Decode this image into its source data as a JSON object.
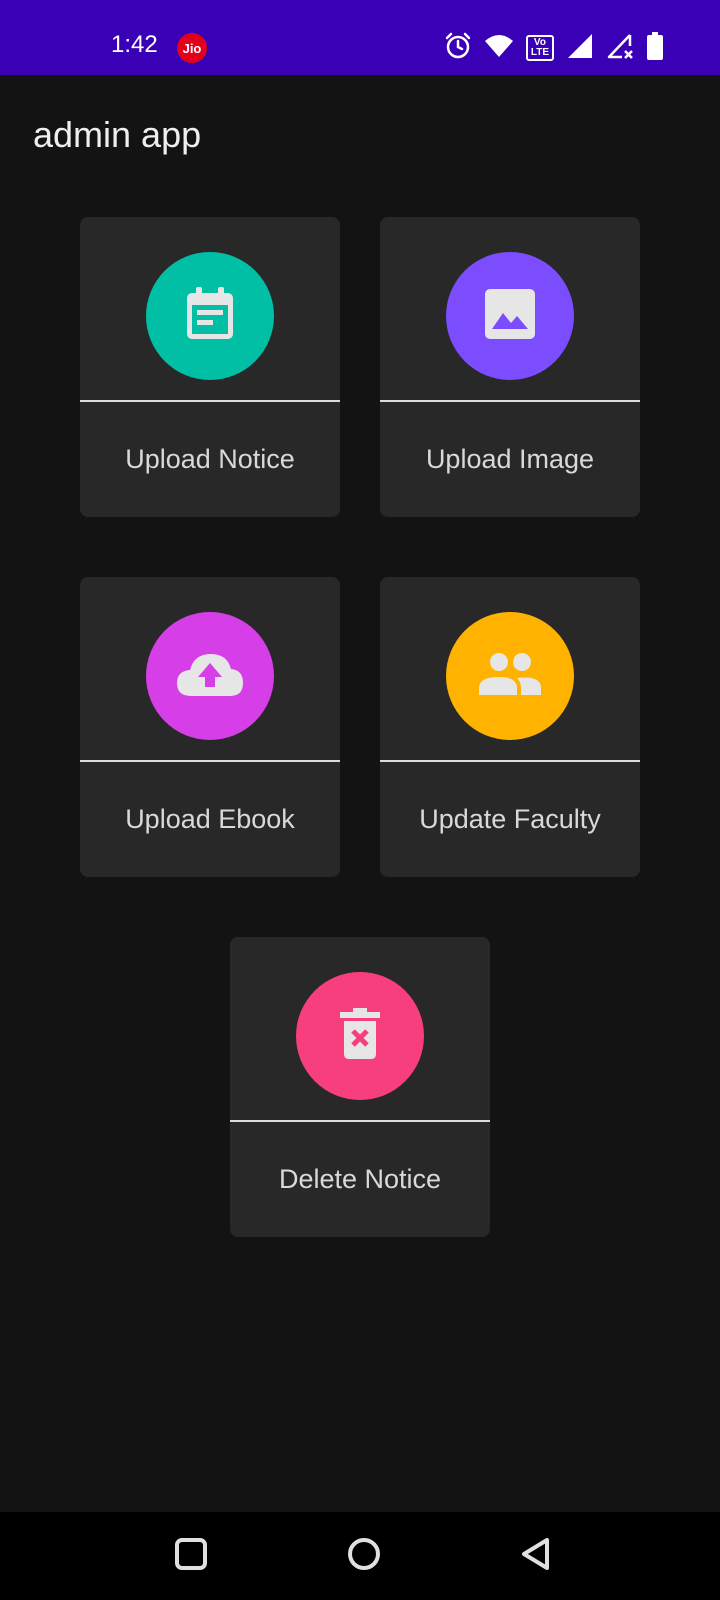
{
  "status_bar": {
    "time": "1:42",
    "carrier_badge": "Jio",
    "volte_top": "Vo",
    "volte_bottom": "LTE",
    "icons": [
      "alarm-icon",
      "wifi-icon",
      "volte-icon",
      "signal-icon",
      "signal-no-service-icon",
      "battery-icon"
    ]
  },
  "app_bar": {
    "title": "admin app"
  },
  "cards": [
    {
      "label": "Upload Notice",
      "icon": "notice-icon",
      "color": "#00bfa5"
    },
    {
      "label": "Upload Image",
      "icon": "image-icon",
      "color": "#7c4dff"
    },
    {
      "label": "Upload Ebook",
      "icon": "cloud-upload-icon",
      "color": "#d63ee8"
    },
    {
      "label": "Update Faculty",
      "icon": "people-icon",
      "color": "#ffb300"
    },
    {
      "label": "Delete Notice",
      "icon": "delete-icon",
      "color": "#f73e7f"
    }
  ],
  "nav_bar": {
    "buttons": [
      "recents-icon",
      "home-icon",
      "back-icon"
    ]
  }
}
